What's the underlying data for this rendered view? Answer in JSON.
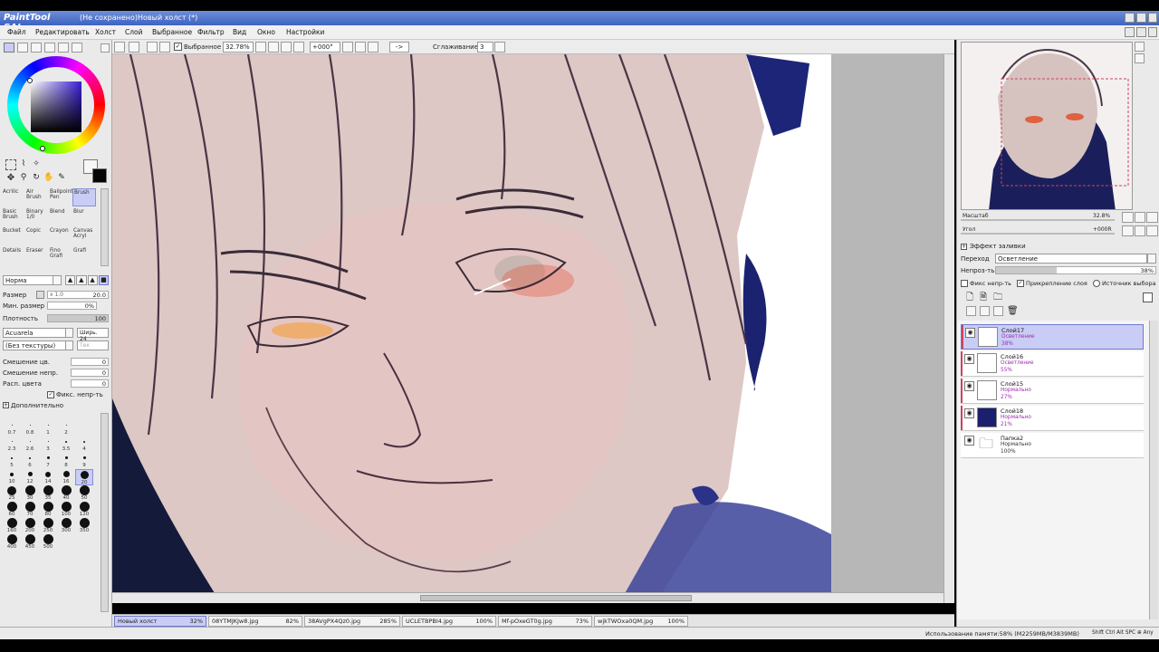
{
  "titlebar": {
    "app_logo": "PaintTool SAI",
    "title": "(Не сохранено)Новый холст (*)"
  },
  "menu": [
    "Файл",
    "Редактировать",
    "Холст",
    "Слой",
    "Выбранное",
    "Фильтр",
    "Вид",
    "Окно",
    "Настройки"
  ],
  "toolbar": {
    "selection_label": "Выбранное",
    "zoom": "32.78%",
    "angle": "+000°",
    "arrow": "->",
    "smoothing_label": "Сглаживание",
    "smoothing_value": "3"
  },
  "tools": [
    {
      "label": "Acrilic"
    },
    {
      "label": "Air Brush"
    },
    {
      "label": "Ballpoint Pen"
    },
    {
      "label": "Brush"
    },
    {
      "label": "Basic Brush"
    },
    {
      "label": "Binary 1/0"
    },
    {
      "label": "Blend"
    },
    {
      "label": "Blur"
    },
    {
      "label": "Bucket"
    },
    {
      "label": "Copic"
    },
    {
      "label": "Crayon"
    },
    {
      "label": "Canvas Acryl"
    },
    {
      "label": "Details"
    },
    {
      "label": "Eraser"
    },
    {
      "label": "Fino Grafi"
    },
    {
      "label": "Grafi"
    }
  ],
  "brush": {
    "mode": "Норма",
    "size_label": "Размер",
    "size_mult": "x 1.0",
    "size_value": "20.0",
    "min_size_label": "Мин. размер",
    "min_size_value": "0%",
    "density_label": "Плотность",
    "density_value": "100",
    "texture_name": "Acuarela",
    "texture_side": "Ширь. 24",
    "no_texture": "(Без текстуры)",
    "no_texture_side": "Тек",
    "mix_color_label": "Смешение цв.",
    "mix_color_value": "0",
    "mix_opacity_label": "Смешение непр.",
    "mix_opacity_value": "0",
    "dilute_label": "Расп. цвета",
    "dilute_value": "0",
    "fix_opacity_label": "Фикс. непр-ть",
    "extra_label": "Дополнительно"
  },
  "brush_sizes": [
    {
      "label": "0.7",
      "dot": 1
    },
    {
      "label": "0.8",
      "dot": 1
    },
    {
      "label": "1",
      "dot": 1
    },
    {
      "label": "2",
      "dot": 1
    },
    {
      "label": "",
      "dot": 0
    },
    {
      "label": "2.3",
      "dot": 1
    },
    {
      "label": "2.6",
      "dot": 1
    },
    {
      "label": "3",
      "dot": 1
    },
    {
      "label": "3.5",
      "dot": 2
    },
    {
      "label": "4",
      "dot": 2
    },
    {
      "label": "5",
      "dot": 2
    },
    {
      "label": "6",
      "dot": 2
    },
    {
      "label": "7",
      "dot": 3
    },
    {
      "label": "8",
      "dot": 3
    },
    {
      "label": "9",
      "dot": 3
    },
    {
      "label": "10",
      "dot": 4
    },
    {
      "label": "12",
      "dot": 5
    },
    {
      "label": "14",
      "dot": 6
    },
    {
      "label": "16",
      "dot": 7
    },
    {
      "label": "20",
      "dot": 9
    },
    {
      "label": "25",
      "dot": 10
    },
    {
      "label": "30",
      "dot": 11
    },
    {
      "label": "35",
      "dot": 11
    },
    {
      "label": "40",
      "dot": 11
    },
    {
      "label": "50",
      "dot": 11
    },
    {
      "label": "60",
      "dot": 11
    },
    {
      "label": "70",
      "dot": 11
    },
    {
      "label": "80",
      "dot": 11
    },
    {
      "label": "100",
      "dot": 11
    },
    {
      "label": "120",
      "dot": 11
    },
    {
      "label": "160",
      "dot": 11
    },
    {
      "label": "200",
      "dot": 11
    },
    {
      "label": "250",
      "dot": 11
    },
    {
      "label": "300",
      "dot": 11
    },
    {
      "label": "350",
      "dot": 11
    },
    {
      "label": "400",
      "dot": 11
    },
    {
      "label": "450",
      "dot": 11
    },
    {
      "label": "500",
      "dot": 11
    }
  ],
  "navigator": {
    "zoom_label": "Масштаб",
    "zoom_value": "32.8%",
    "angle_label": "Угол",
    "angle_value": "+000R"
  },
  "layer_panel": {
    "fill_effect_label": "Эффект заливки",
    "blend_label": "Переход",
    "blend_value": "Осветление",
    "opacity_label": "Непроз-ть",
    "opacity_value": "38%",
    "opacity_fraction": 0.38,
    "fix_opacity": "Фикс непр-ть",
    "clip_layer": "Прикрепление слоя",
    "selection_source": "Источник выбора"
  },
  "layers": [
    {
      "name": "Слой17",
      "mode": "Осветление",
      "opacity": "38%",
      "selected": true,
      "color": "#ffffff"
    },
    {
      "name": "Слой16",
      "mode": "Осветление",
      "opacity": "55%",
      "selected": false,
      "color": "#ffffff"
    },
    {
      "name": "Слой15",
      "mode": "Нормально",
      "opacity": "27%",
      "selected": false,
      "color": "#ffffff"
    },
    {
      "name": "Слой18",
      "mode": "Нормально",
      "opacity": "21%",
      "selected": false,
      "color": "#1a1f6e"
    },
    {
      "name": "Папка2",
      "mode": "Нормально",
      "opacity": "100%",
      "selected": false,
      "color": "folder"
    }
  ],
  "tabs": [
    {
      "name": "Новый холст",
      "pct": "32%",
      "selected": true
    },
    {
      "name": "08YTMJKJw8.jpg",
      "pct": "82%",
      "selected": false
    },
    {
      "name": "38AVgPX4Qz0.jpg",
      "pct": "285%",
      "selected": false
    },
    {
      "name": "UCLETBPBI4.jpg",
      "pct": "100%",
      "selected": false
    },
    {
      "name": "Mf-pOxeGT0g.jpg",
      "pct": "73%",
      "selected": false
    },
    {
      "name": "wjkTWOxa0QM.jpg",
      "pct": "100%",
      "selected": false
    }
  ],
  "status": {
    "memory": "Использование памяти:58% (М2259MB/М3839MB)",
    "keys": "Shift Ctrl Alt SPC ⊕ Any"
  },
  "colors": {
    "accent": "#c9cdf5",
    "title_bar": "#3c62c2",
    "canvas_bg": "#b7b7b7",
    "skin": "#d9c4c2"
  }
}
